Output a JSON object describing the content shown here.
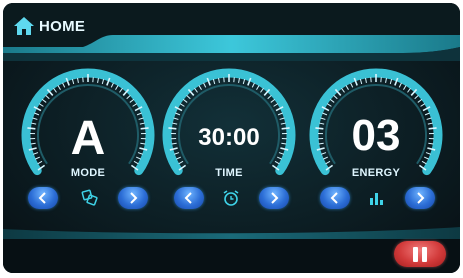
{
  "header": {
    "home_label": "HOME"
  },
  "dials": [
    {
      "id": "mode",
      "value": "A",
      "caption": "MODE",
      "icon": "mode-icon"
    },
    {
      "id": "time",
      "value": "30:00",
      "caption": "TIME",
      "icon": "alarm-clock-icon"
    },
    {
      "id": "energy",
      "value": "03",
      "caption": "ENERGY",
      "icon": "bar-chart-icon"
    }
  ],
  "controls": {
    "pause_icon": "pause-icon"
  },
  "colors": {
    "accent": "#3fd3e8",
    "background": "#0a1216",
    "nav_button": "#2c6ed6",
    "pause_button": "#d23b3b"
  }
}
